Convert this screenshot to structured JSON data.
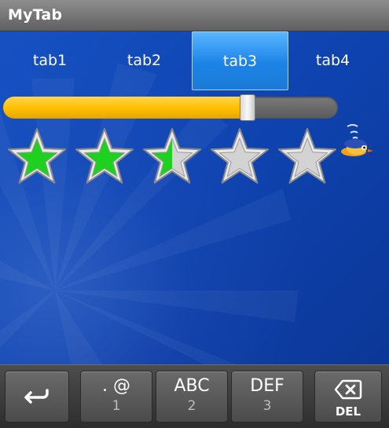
{
  "app": {
    "title": "MyTab"
  },
  "tabs": [
    {
      "label": "tab1",
      "selected": false
    },
    {
      "label": "tab2",
      "selected": false
    },
    {
      "label": "tab3",
      "selected": true
    },
    {
      "label": "tab4",
      "selected": false
    }
  ],
  "seekbar": {
    "progress": 0.73
  },
  "rating": {
    "value": 2.5,
    "max": 5
  },
  "keyboard": {
    "back_icon": "back-arrow-icon",
    "keys": [
      {
        "main": ". @",
        "sub": "1"
      },
      {
        "main": "ABC",
        "sub": "2"
      },
      {
        "main": "DEF",
        "sub": "3"
      }
    ],
    "del_label": "DEL",
    "del_icon": "backspace-icon"
  },
  "colors": {
    "tab_selected": "#1b83e6",
    "seek_fill": "#ffbf00",
    "star_filled": "#1fd11f",
    "star_empty": "#d3d3d3",
    "background": "#0f44b2"
  }
}
